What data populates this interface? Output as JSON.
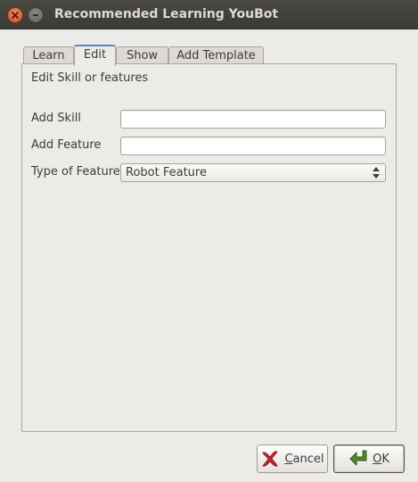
{
  "window": {
    "title": "Recommended Learning YouBot"
  },
  "tabs": [
    {
      "label": "Learn",
      "active": false
    },
    {
      "label": "Edit",
      "active": true
    },
    {
      "label": "Show",
      "active": false
    },
    {
      "label": "Add Template",
      "active": false
    }
  ],
  "edit_panel": {
    "heading": "Edit Skill or features",
    "add_skill": {
      "label": "Add Skill",
      "value": ""
    },
    "add_feature": {
      "label": "Add Feature",
      "value": ""
    },
    "type_of_feature": {
      "label": "Type of Feature",
      "selected": "Robot Feature"
    }
  },
  "buttons": {
    "cancel_prefix": "",
    "cancel_mnemonic": "C",
    "cancel_rest": "ancel",
    "ok_mnemonic": "O",
    "ok_rest": "K"
  },
  "icons": {
    "close": "close-icon",
    "minimize": "minimize-icon",
    "cancel": "red-x-icon",
    "ok": "green-return-arrow-icon",
    "combo": "updown-arrows-icon"
  },
  "colors": {
    "titlebar": "#3f3e3a",
    "window_bg": "#edebe8",
    "close_button": "#e0632f",
    "active_tab_accent": "#5e88c1",
    "cancel_icon": "#c8262b",
    "ok_icon": "#4e8a2c"
  }
}
